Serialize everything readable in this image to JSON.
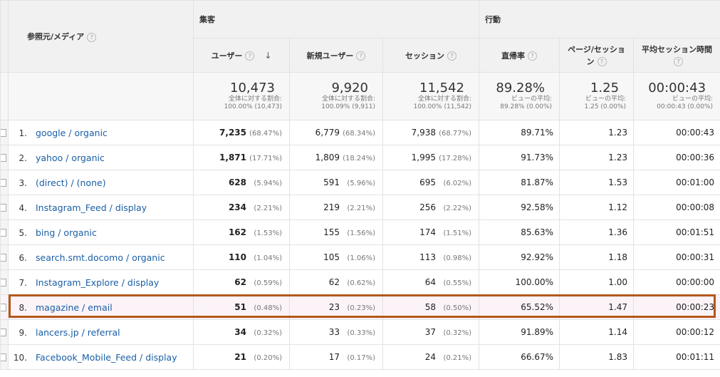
{
  "header": {
    "dimension_label": "参照元/メディア",
    "group_acquisition": "集客",
    "group_behavior": "行動",
    "col_users": "ユーザー",
    "col_new_users": "新規ユーザー",
    "col_sessions": "セッション",
    "col_bounce": "直帰率",
    "col_pages_line1": "ページ/セッショ",
    "col_pages_line2": "ン",
    "col_duration": "平均セッション時間",
    "help_icon": "?",
    "sort_icon": "↓"
  },
  "totals": {
    "users": {
      "value": "10,473",
      "line1": "全体に対する割合:",
      "line2": "100.00% (10,473)"
    },
    "new_users": {
      "value": "9,920",
      "line1": "全体に対する割合:",
      "line2": "100.09% (9,911)"
    },
    "sessions": {
      "value": "11,542",
      "line1": "全体に対する割合:",
      "line2": "100.00% (11,542)"
    },
    "bounce": {
      "value": "89.28%",
      "line1": "ビューの平均:",
      "line2": "89.28% (0.00%)"
    },
    "pages": {
      "value": "1.25",
      "line1": "ビューの平均:",
      "line2": "1.25 (0.00%)"
    },
    "duration": {
      "value": "00:00:43",
      "line1": "ビューの平均:",
      "line2": "00:00:43 (0.00%)"
    }
  },
  "rows": [
    {
      "idx": "1.",
      "source": "google / organic",
      "users": "7,235",
      "users_pct": "(68.47%)",
      "new_users": "6,779",
      "new_users_pct": "(68.34%)",
      "sessions": "7,938",
      "sessions_pct": "(68.77%)",
      "bounce": "89.71%",
      "pages": "1.23",
      "duration": "00:00:43"
    },
    {
      "idx": "2.",
      "source": "yahoo / organic",
      "users": "1,871",
      "users_pct": "(17.71%)",
      "new_users": "1,809",
      "new_users_pct": "(18.24%)",
      "sessions": "1,995",
      "sessions_pct": "(17.28%)",
      "bounce": "91.73%",
      "pages": "1.23",
      "duration": "00:00:36"
    },
    {
      "idx": "3.",
      "source": "(direct) / (none)",
      "users": "628",
      "users_pct": "(5.94%)",
      "new_users": "591",
      "new_users_pct": "(5.96%)",
      "sessions": "695",
      "sessions_pct": "(6.02%)",
      "bounce": "81.87%",
      "pages": "1.53",
      "duration": "00:01:00"
    },
    {
      "idx": "4.",
      "source": "Instagram_Feed / display",
      "users": "234",
      "users_pct": "(2.21%)",
      "new_users": "219",
      "new_users_pct": "(2.21%)",
      "sessions": "256",
      "sessions_pct": "(2.22%)",
      "bounce": "92.58%",
      "pages": "1.12",
      "duration": "00:00:08"
    },
    {
      "idx": "5.",
      "source": "bing / organic",
      "users": "162",
      "users_pct": "(1.53%)",
      "new_users": "155",
      "new_users_pct": "(1.56%)",
      "sessions": "174",
      "sessions_pct": "(1.51%)",
      "bounce": "85.63%",
      "pages": "1.36",
      "duration": "00:01:51"
    },
    {
      "idx": "6.",
      "source": "search.smt.docomo / organic",
      "users": "110",
      "users_pct": "(1.04%)",
      "new_users": "105",
      "new_users_pct": "(1.06%)",
      "sessions": "113",
      "sessions_pct": "(0.98%)",
      "bounce": "92.92%",
      "pages": "1.18",
      "duration": "00:00:31"
    },
    {
      "idx": "7.",
      "source": "Instagram_Explore / display",
      "users": "62",
      "users_pct": "(0.59%)",
      "new_users": "62",
      "new_users_pct": "(0.62%)",
      "sessions": "64",
      "sessions_pct": "(0.55%)",
      "bounce": "100.00%",
      "pages": "1.00",
      "duration": "00:00:00"
    },
    {
      "idx": "8.",
      "source": "magazine / email",
      "users": "51",
      "users_pct": "(0.48%)",
      "new_users": "23",
      "new_users_pct": "(0.23%)",
      "sessions": "58",
      "sessions_pct": "(0.50%)",
      "bounce": "65.52%",
      "pages": "1.47",
      "duration": "00:00:23"
    },
    {
      "idx": "9.",
      "source": "lancers.jp / referral",
      "users": "34",
      "users_pct": "(0.32%)",
      "new_users": "33",
      "new_users_pct": "(0.33%)",
      "sessions": "37",
      "sessions_pct": "(0.32%)",
      "bounce": "91.89%",
      "pages": "1.14",
      "duration": "00:00:12"
    },
    {
      "idx": "10.",
      "source": "Facebook_Mobile_Feed / display",
      "users": "21",
      "users_pct": "(0.20%)",
      "new_users": "17",
      "new_users_pct": "(0.17%)",
      "sessions": "24",
      "sessions_pct": "(0.21%)",
      "bounce": "66.67%",
      "pages": "1.83",
      "duration": "00:01:11"
    }
  ],
  "colors": {
    "link": "#1a5fa5",
    "highlight_border": "#b4571b",
    "header_bg": "#f1f1f1"
  }
}
